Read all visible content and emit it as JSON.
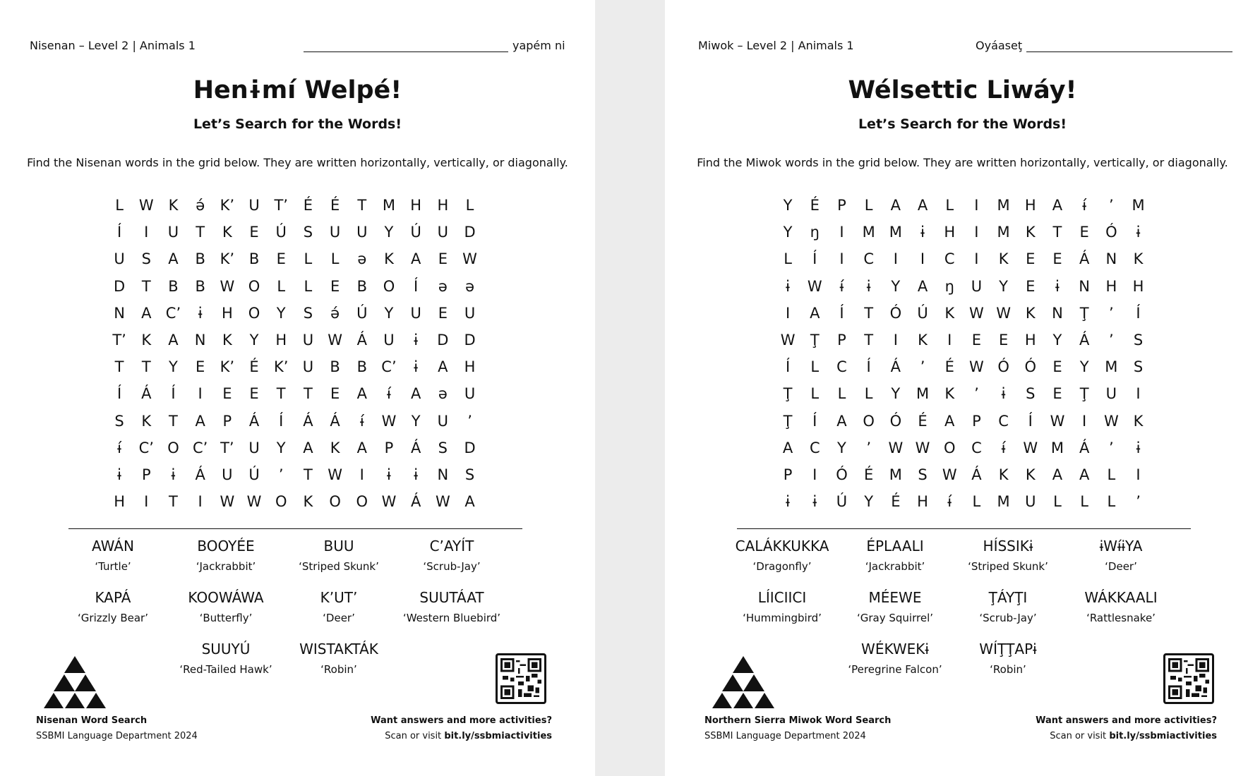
{
  "left": {
    "header_left": "Nisenan – Level 2 | Animals 1",
    "header_right": "yapém ni",
    "title": "Henɨmí Welpé!",
    "subtitle": "Let’s Search for the Words!",
    "instructions": "Find the Nisenan words in the grid below. They are written horizontally, vertically, or diagonally.",
    "grid": [
      [
        "L",
        "W",
        "K",
        "ə́",
        "K’",
        "U",
        "T’",
        "É",
        "É",
        "T",
        "M",
        "H",
        "H",
        "L"
      ],
      [
        "Í",
        "I",
        "U",
        "T",
        "K",
        "E",
        "Ú",
        "S",
        "U",
        "U",
        "Y",
        "Ú",
        "U",
        "D"
      ],
      [
        "U",
        "S",
        "A",
        "B",
        "K’",
        "B",
        "E",
        "L",
        "L",
        "ə",
        "K",
        "A",
        "E",
        "W"
      ],
      [
        "D",
        "T",
        "B",
        "B",
        "W",
        "O",
        "L",
        "L",
        "E",
        "B",
        "O",
        "Í",
        "ə",
        "ə"
      ],
      [
        "N",
        "A",
        "C’",
        "ɨ",
        "H",
        "O",
        "Y",
        "S",
        "ə́",
        "Ú",
        "Y",
        "U",
        "E",
        "U"
      ],
      [
        "T’",
        "K",
        "A",
        "N",
        "K",
        "Y",
        "H",
        "U",
        "W",
        "Á",
        "U",
        "ɨ",
        "D",
        "D"
      ],
      [
        "T",
        "T",
        "Y",
        "E",
        "K’",
        "É",
        "K’",
        "U",
        "B",
        "B",
        "C’",
        "ɨ",
        "A",
        "H"
      ],
      [
        "Í",
        "Á",
        "Í",
        "I",
        "E",
        "E",
        "T",
        "T",
        "E",
        "A",
        "ɨ́",
        "A",
        "ə",
        "U"
      ],
      [
        "S",
        "K",
        "T",
        "A",
        "P",
        "Á",
        "Í",
        "Á",
        "Á",
        "ɨ́",
        "W",
        "Y",
        "U",
        "’"
      ],
      [
        "ɨ́",
        "C’",
        "O",
        "C’",
        "T’",
        "U",
        "Y",
        "A",
        "K",
        "A",
        "P",
        "Á",
        "S",
        "D"
      ],
      [
        "ɨ",
        "P",
        "ɨ",
        "Á",
        "U",
        "Ú",
        "’",
        "T",
        "W",
        "I",
        "ɨ",
        "ɨ",
        "N",
        "S"
      ],
      [
        "H",
        "I",
        "T",
        "I",
        "W",
        "W",
        "O",
        "K",
        "O",
        "O",
        "W",
        "Á",
        "W",
        "A"
      ]
    ],
    "word_rows": [
      [
        {
          "w": "AWÁN",
          "t": "‘Turtle’"
        },
        {
          "w": "BOOYÉE",
          "t": "‘Jackrabbit’"
        },
        {
          "w": "BUU",
          "t": "‘Striped Skunk’"
        },
        {
          "w": "C’AYÍT",
          "t": "‘Scrub-Jay’"
        }
      ],
      [
        {
          "w": "KAPÁ",
          "t": "‘Grizzly Bear’"
        },
        {
          "w": "KOOWÁWA",
          "t": "‘Butterfly’"
        },
        {
          "w": "K’UT’",
          "t": "‘Deer’"
        },
        {
          "w": "SUUTÁAT",
          "t": "‘Western Bluebird’"
        }
      ],
      [
        {
          "w": "SUUYÚ",
          "t": "‘Red-Tailed Hawk’"
        },
        {
          "w": "WISTAKTÁK",
          "t": "‘Robin’"
        }
      ]
    ],
    "footer_title": "Nisenan Word Search",
    "footer_sub": "SSBMI Language Department 2024",
    "cta": "Want answers and more activities?",
    "cta_prefix": "Scan or visit",
    "cta_link": "bit.ly/ssbmiactivities"
  },
  "right": {
    "header_left": "Miwok – Level 2 | Animals 1",
    "header_right": "Oyáaseţ",
    "title": "Wélsettic Liwáy!",
    "subtitle": "Let’s Search for the Words!",
    "instructions": "Find the Miwok words in the grid below. They are written horizontally, vertically, or diagonally.",
    "grid": [
      [
        "Y",
        "É",
        "P",
        "L",
        "A",
        "A",
        "L",
        "I",
        "M",
        "H",
        "A",
        "ɨ́",
        "’",
        "M"
      ],
      [
        "Y",
        "ŋ",
        "I",
        "M",
        "M",
        "ɨ",
        "H",
        "I",
        "M",
        "K",
        "T",
        "E",
        "Ó",
        "ɨ"
      ],
      [
        "L",
        "Í",
        "I",
        "C",
        "I",
        "I",
        "C",
        "I",
        "K",
        "E",
        "E",
        "Á",
        "N",
        "K"
      ],
      [
        "ɨ",
        "W",
        "ɨ́",
        "ɨ",
        "Y",
        "A",
        "ŋ",
        "U",
        "Y",
        "E",
        "ɨ",
        "N",
        "H",
        "H"
      ],
      [
        "I",
        "A",
        "Í",
        "T",
        "Ó",
        "Ú",
        "K",
        "W",
        "W",
        "K",
        "N",
        "Ţ",
        "’",
        "Í"
      ],
      [
        "W",
        "Ţ",
        "P",
        "T",
        "I",
        "K",
        "I",
        "E",
        "E",
        "H",
        "Y",
        "Á",
        "’",
        "S"
      ],
      [
        "Í",
        "L",
        "C",
        "Í",
        "Á",
        "’",
        "É",
        "W",
        "Ó",
        "Ó",
        "E",
        "Y",
        "M",
        "S"
      ],
      [
        "Ţ",
        "L",
        "L",
        "L",
        "Y",
        "M",
        "K",
        "’",
        "ɨ",
        "S",
        "E",
        "Ţ",
        "U",
        "I"
      ],
      [
        "Ţ",
        "Í",
        "A",
        "O",
        "Ó",
        "É",
        "A",
        "P",
        "C",
        "Í",
        "W",
        "I",
        "W",
        "K"
      ],
      [
        "A",
        "C",
        "Y",
        "’",
        "W",
        "W",
        "O",
        "C",
        "ɨ́",
        "W",
        "M",
        "Á",
        "’",
        "ɨ"
      ],
      [
        "P",
        "I",
        "Ó",
        "É",
        "M",
        "S",
        "W",
        "Á",
        "K",
        "K",
        "A",
        "A",
        "L",
        "I"
      ],
      [
        "ɨ",
        "ɨ",
        "Ú",
        "Y",
        "É",
        "H",
        "ɨ́",
        "L",
        "M",
        "U",
        "L",
        "L",
        "L",
        "’"
      ]
    ],
    "word_rows": [
      [
        {
          "w": "CALÁKKUKKA",
          "t": "‘Dragonfly’"
        },
        {
          "w": "ÉPLAALI",
          "t": "‘Jackrabbit’"
        },
        {
          "w": "HÍSSIKɨ",
          "t": "‘Striped Skunk’"
        },
        {
          "w": "ɨWɨ́ɨYA",
          "t": "‘Deer’"
        }
      ],
      [
        {
          "w": "LÍICIICI",
          "t": "‘Hummingbird’"
        },
        {
          "w": "MÉEWE",
          "t": "‘Gray Squirrel’"
        },
        {
          "w": "ŢÁYŢI",
          "t": "‘Scrub-Jay’"
        },
        {
          "w": "WÁKKAALI",
          "t": "‘Rattlesnake’"
        }
      ],
      [
        {
          "w": "WÉKWEKɨ",
          "t": "‘Peregrine Falcon’"
        },
        {
          "w": "WÍŢŢAPɨ",
          "t": "‘Robin’"
        }
      ]
    ],
    "footer_title": "Northern Sierra Miwok Word Search",
    "footer_sub": "SSBMI Language Department 2024",
    "cta": "Want answers and more activities?",
    "cta_prefix": "Scan or visit",
    "cta_link": "bit.ly/ssbmiactivities"
  }
}
